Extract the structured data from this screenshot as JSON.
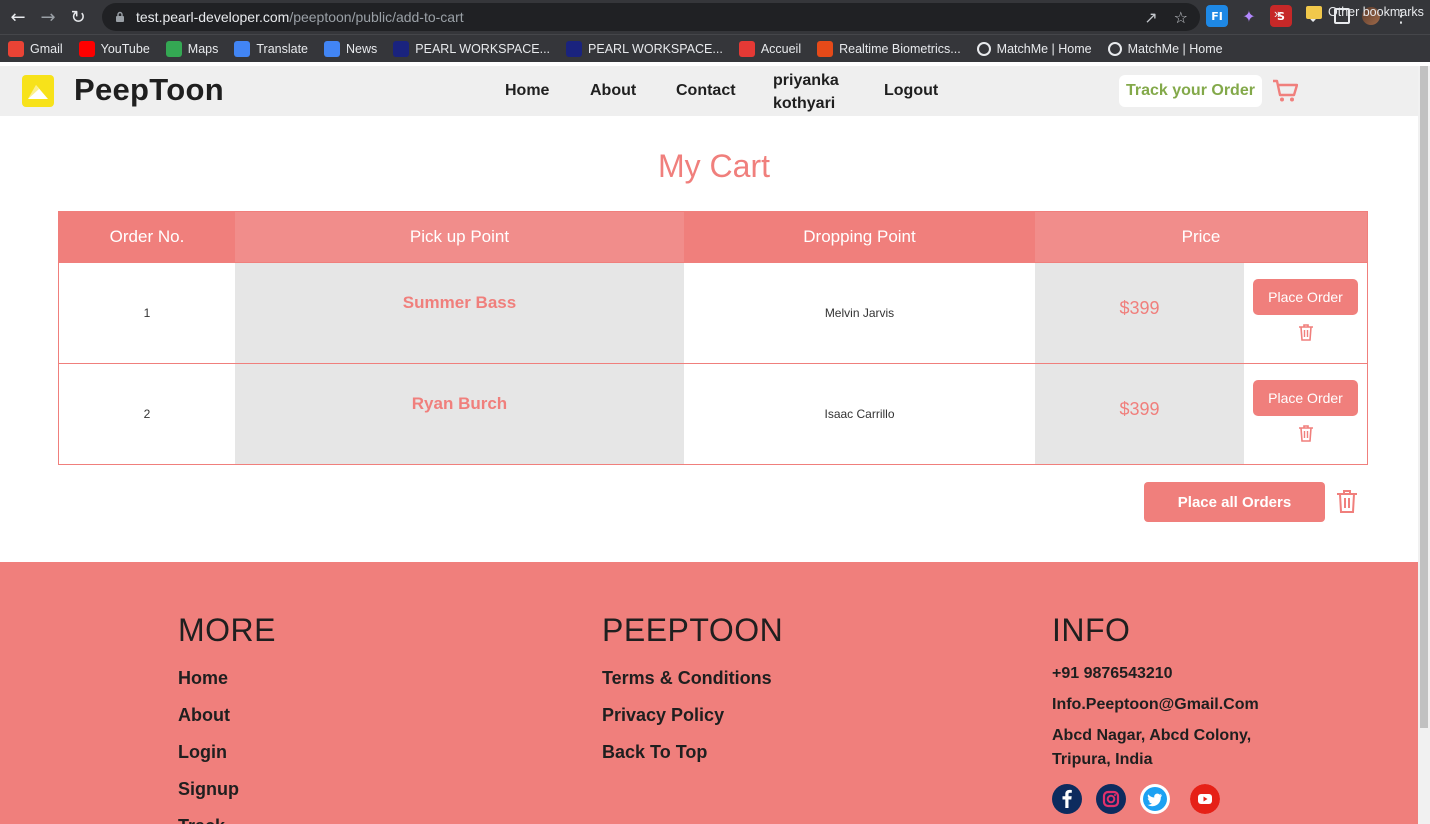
{
  "browser": {
    "url_host": "test.pearl-developer.com",
    "url_path": "/peeptoon/public/add-to-cart",
    "bookmarks": [
      {
        "label": "Gmail",
        "icon": "gmail-icon",
        "color": "#ea4335"
      },
      {
        "label": "YouTube",
        "icon": "youtube-icon",
        "color": "#ff0000"
      },
      {
        "label": "Maps",
        "icon": "maps-icon",
        "color": "#34a853"
      },
      {
        "label": "Translate",
        "icon": "translate-icon",
        "color": "#4285f4"
      },
      {
        "label": "News",
        "icon": "news-icon",
        "color": "#4285f4"
      },
      {
        "label": "PEARL WORKSPACE...",
        "icon": "pearl-icon",
        "color": "#1a237e"
      },
      {
        "label": "PEARL WORKSPACE...",
        "icon": "pearl-icon",
        "color": "#1a237e"
      },
      {
        "label": "Accueil",
        "icon": "accueil-icon",
        "color": "#e53935"
      },
      {
        "label": "Realtime Biometrics...",
        "icon": "biometrics-icon",
        "color": "#e64a19"
      },
      {
        "label": "MatchMe | Home",
        "icon": "globe-icon",
        "color": "#e8eaed"
      },
      {
        "label": "MatchMe | Home",
        "icon": "globe-icon",
        "color": "#e8eaed"
      }
    ],
    "more": "»",
    "other_bookmarks": "Other bookmarks"
  },
  "header": {
    "brand": "PeepToon",
    "nav": {
      "home": "Home",
      "about": "About",
      "contact": "Contact",
      "user_first": "priyanka",
      "user_last": "kothyari",
      "logout": "Logout"
    },
    "track": "Track your Order"
  },
  "cart": {
    "title": "My Cart",
    "columns": {
      "order_no": "Order No.",
      "pickup": "Pick up Point",
      "dropping": "Dropping Point",
      "price": "Price"
    },
    "rows": [
      {
        "order_no": "1",
        "pickup": "Summer Bass",
        "dropping": "Melvin Jarvis",
        "price": "$399",
        "action": "Place Order"
      },
      {
        "order_no": "2",
        "pickup": "Ryan Burch",
        "dropping": "Isaac Carrillo",
        "price": "$399",
        "action": "Place Order"
      }
    ],
    "place_all": "Place all Orders"
  },
  "footer": {
    "more": {
      "title": "MORE",
      "links": [
        "Home",
        "About",
        "Login",
        "Signup",
        "Track"
      ]
    },
    "peeptoon": {
      "title": "PEEPTOON",
      "links": [
        "Terms & Conditions",
        "Privacy Policy",
        "Back To Top"
      ]
    },
    "info": {
      "title": "INFO",
      "phone": "+91 9876543210",
      "email": "Info.Peeptoon@Gmail.Com",
      "address_line1": "Abcd Nagar, Abcd Colony,",
      "address_line2": "Tripura, India"
    }
  },
  "colors": {
    "accent": "#f07f7c",
    "track_green": "#83a94a"
  }
}
